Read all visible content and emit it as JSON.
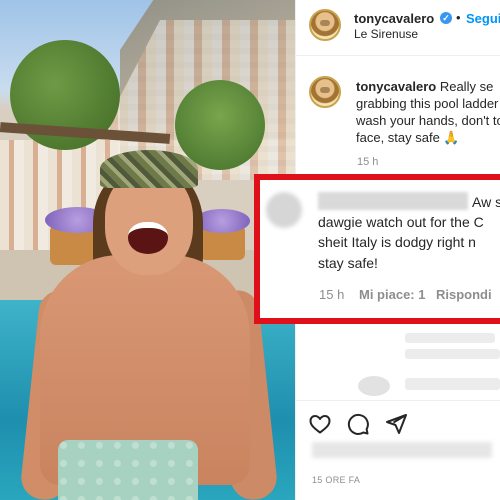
{
  "post": {
    "username": "tonycavalero",
    "verified_badge": "✓",
    "separator": "•",
    "follow_label": "Segui",
    "location": "Le Sirenuse"
  },
  "caption": {
    "username": "tonycavalero",
    "lines": [
      "Really se",
      "grabbing this pool ladder",
      "wash your hands, don't to",
      "face, stay safe 🙏"
    ],
    "time": "15 h"
  },
  "highlighted_comment": {
    "lines": [
      "Aw s",
      "dawgie watch out for the C",
      "sheit Italy is dodgy right n",
      "stay safe!"
    ],
    "time": "15 h",
    "likes": "Mi piace: 1",
    "reply": "Rispondi"
  },
  "footer": {
    "time_ago": "15 ORE FA"
  },
  "colors": {
    "highlight": "#e0101b",
    "link": "#0095f6",
    "verified": "#3897f0",
    "text": "#262626",
    "muted": "#8e8e8e"
  },
  "icons": [
    "heart-icon",
    "comment-icon",
    "share-icon"
  ]
}
